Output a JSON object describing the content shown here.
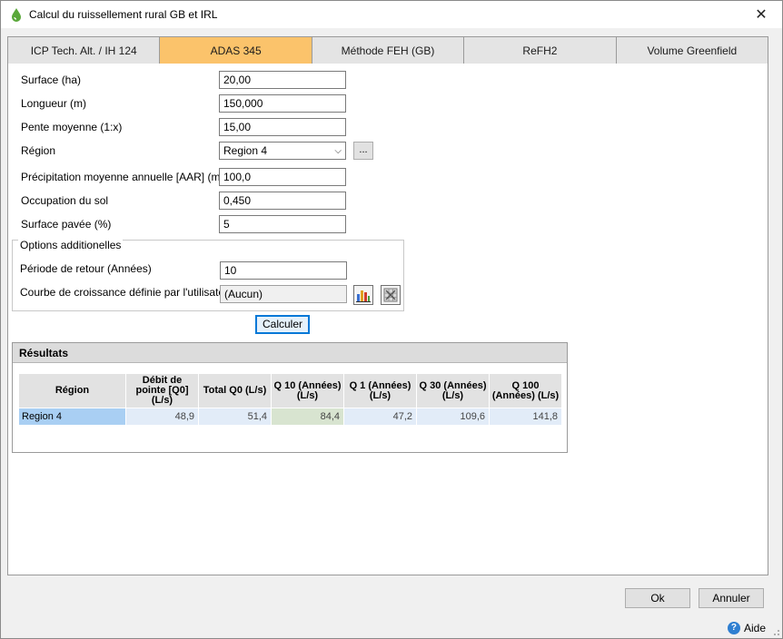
{
  "window": {
    "title": "Calcul du ruissellement rural GB et IRL",
    "close_glyph": "✕"
  },
  "tabs": [
    {
      "label": "ICP Tech. Alt. / IH 124",
      "active": false
    },
    {
      "label": "ADAS 345",
      "active": true
    },
    {
      "label": "Méthode FEH (GB)",
      "active": false
    },
    {
      "label": "ReFH2",
      "active": false
    },
    {
      "label": "Volume Greenfield",
      "active": false
    }
  ],
  "form": {
    "surface": {
      "label": "Surface (ha)",
      "value": "20,00"
    },
    "longueur": {
      "label": "Longueur (m)",
      "value": "150,000"
    },
    "pente": {
      "label": "Pente moyenne (1:x)",
      "value": "15,00"
    },
    "region": {
      "label": "Région",
      "value": "Region 4",
      "browse_label": "..."
    },
    "aar": {
      "label": "Précipitation moyenne annuelle [AAR] (mm)",
      "value": "100,0"
    },
    "occupation": {
      "label": "Occupation du sol",
      "value": "0,450"
    },
    "pavee": {
      "label": "Surface pavée (%)",
      "value": "5"
    }
  },
  "options": {
    "title": "Options additionelles",
    "periode": {
      "label": "Période de retour (Années)",
      "value": "10"
    },
    "courbe": {
      "label": "Courbe de croissance définie par l'utilisateur",
      "value": "(Aucun)"
    }
  },
  "calculate_label": "Calculer",
  "results": {
    "title": "Résultats",
    "columns": [
      "Région",
      "Débit de pointe [Q0] (L/s)",
      "Total Q0 (L/s)",
      "Q 10 (Années) (L/s)",
      "Q 1 (Années) (L/s)",
      "Q 30 (Années) (L/s)",
      "Q 100 (Années) (L/s)"
    ],
    "rows": [
      [
        "Region 4",
        "48,9",
        "51,4",
        "84,4",
        "47,2",
        "109,6",
        "141,8"
      ]
    ]
  },
  "footer": {
    "ok_label": "Ok",
    "cancel_label": "Annuler",
    "help_label": "Aide",
    "help_glyph": "?"
  },
  "colors": {
    "active_tab": "#fbc36b",
    "selected_row_header": "#a9cff3",
    "focus_border": "#0078d7"
  }
}
